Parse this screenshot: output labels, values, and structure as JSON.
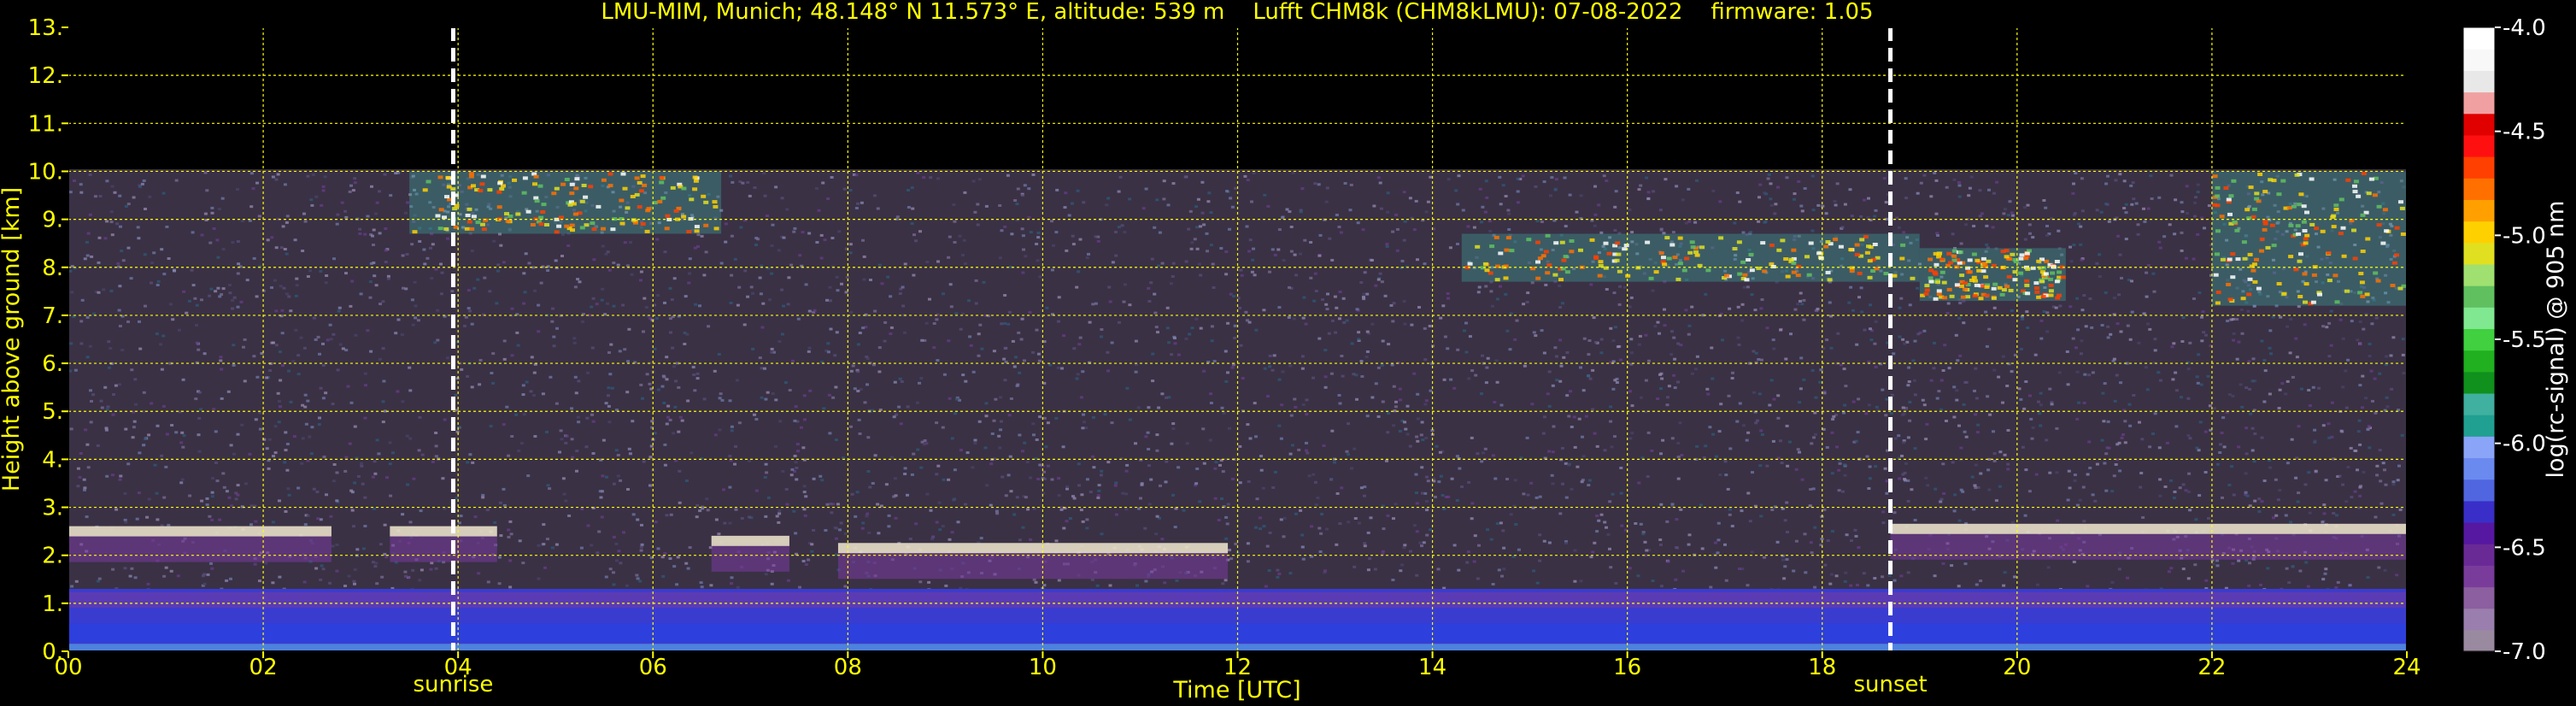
{
  "title": "LMU-MIM, Munich; 48.148° N 11.573° E, altitude: 539 m    Lufft CHM8k (CHM8kLMU): 07-08-2022    firmware: 1.05",
  "colors": {
    "background": "#000000",
    "axis_text": "#ffff00",
    "grid": "#ffff00",
    "marker_lines": "#ffffff",
    "colorbar_text": "#ffffff"
  },
  "chart_data": {
    "type": "heatmap",
    "title": "LMU-MIM, Munich; 48.148° N 11.573° E, altitude: 539 m    Lufft CHM8k (CHM8kLMU): 07-08-2022    firmware: 1.05",
    "xlabel": "Time [UTC]",
    "ylabel": "Height above ground [km]",
    "xlim": [
      0,
      24
    ],
    "ylim": [
      0,
      13
    ],
    "x_ticks": [
      0,
      2,
      4,
      6,
      8,
      10,
      12,
      14,
      16,
      18,
      20,
      22,
      24
    ],
    "x_tick_labels": [
      "00",
      "02",
      "04",
      "06",
      "08",
      "10",
      "12",
      "14",
      "16",
      "18",
      "20",
      "22",
      "24"
    ],
    "y_ticks": [
      0,
      1,
      2,
      3,
      4,
      5,
      6,
      7,
      8,
      9,
      10,
      11,
      12,
      13
    ],
    "y_tick_labels": [
      "0.",
      "1.",
      "2.",
      "3.",
      "4.",
      "5.",
      "6.",
      "7.",
      "8.",
      "9.",
      "10.",
      "11.",
      "12.",
      "13."
    ],
    "grid": true,
    "data_max_height_km": 10,
    "markers": [
      {
        "label": "sunrise",
        "time_utc": 3.95
      },
      {
        "label": "sunset",
        "time_utc": 18.7
      }
    ],
    "colorbar": {
      "label": "log(rc-signal) @ 905 nm",
      "range": [
        -7.0,
        -4.0
      ],
      "ticks": [
        -4.0,
        -4.5,
        -5.0,
        -5.5,
        -6.0,
        -6.5,
        -7.0
      ],
      "tick_labels": [
        "-4.0",
        "-4.5",
        "-5.0",
        "-5.5",
        "-6.0",
        "-6.5",
        "-7.0"
      ],
      "colors_low_to_high": [
        "#9a8aa0",
        "#9a7fae",
        "#8b5fa0",
        "#7a3c9a",
        "#6a2a96",
        "#5618a0",
        "#3a2ec8",
        "#5066e0",
        "#6a8af0",
        "#8aa4f8",
        "#20a090",
        "#40b0a0",
        "#10901c",
        "#20b020",
        "#40d040",
        "#80e890",
        "#60c060",
        "#a0e070",
        "#e0e020",
        "#ffd000",
        "#ffa000",
        "#ff7000",
        "#ff4000",
        "#ff1010",
        "#e00000",
        "#f0a0a0",
        "#e8e8e8",
        "#f8f8f8",
        "#ffffff"
      ]
    },
    "features": [
      {
        "kind": "boundary_layer",
        "t_start": 0,
        "t_end": 24,
        "h_bottom": 0.0,
        "h_top": 1.3
      },
      {
        "kind": "residual_layer_top",
        "t_start": 0.0,
        "t_end": 2.7,
        "height_km": 2.5
      },
      {
        "kind": "residual_layer_top",
        "t_start": 3.3,
        "t_end": 4.4,
        "height_km": 2.5
      },
      {
        "kind": "residual_layer_top",
        "t_start": 6.6,
        "t_end": 7.4,
        "height_km": 2.3
      },
      {
        "kind": "residual_layer_top",
        "t_start": 7.9,
        "t_end": 11.9,
        "height_km": 2.15
      },
      {
        "kind": "residual_layer_top",
        "t_start": 18.7,
        "t_end": 24.0,
        "height_km": 2.55
      },
      {
        "kind": "cirrus",
        "t_start": 3.5,
        "t_end": 6.7,
        "h_bottom": 8.7,
        "h_top": 10.0
      },
      {
        "kind": "cirrus",
        "t_start": 14.3,
        "t_end": 19.0,
        "h_bottom": 7.7,
        "h_top": 8.7
      },
      {
        "kind": "cirrus",
        "t_start": 19.0,
        "t_end": 20.5,
        "h_bottom": 7.3,
        "h_top": 8.4
      },
      {
        "kind": "cirrus",
        "t_start": 22.0,
        "t_end": 24.0,
        "h_bottom": 7.2,
        "h_top": 10.0
      }
    ]
  }
}
